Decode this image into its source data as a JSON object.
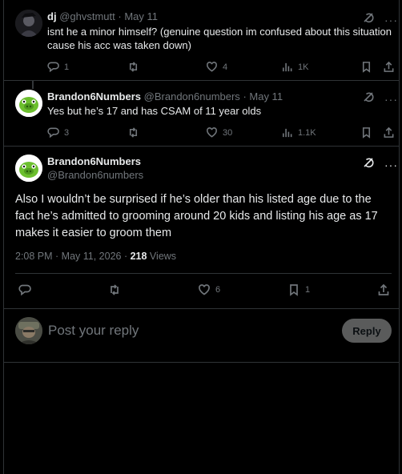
{
  "tweets": [
    {
      "name": "dj",
      "handle": "@ghvstmutt",
      "date": "· May 11",
      "text": "isnt he a minor himself? (genuine question im confused about this situation cause his acc was taken down)",
      "replies": "1",
      "reposts": "",
      "likes": "4",
      "views": "1K"
    },
    {
      "name": "Brandon6Numbers",
      "handle": "@Brandon6numbers",
      "date": "· May 11",
      "text": "Yes but he’s 17 and has CSAM of 11 year olds",
      "replies": "3",
      "reposts": "",
      "likes": "30",
      "views": "1.1K"
    }
  ],
  "main": {
    "name": "Brandon6Numbers",
    "handle": "@Brandon6numbers",
    "text": "Also I wouldn’t be surprised if he’s older than his listed age due to the fact he’s admitted to grooming around 20 kids and listing his age as 17 makes it easier to groom them",
    "timestamp": "2:08 PM · May 11, 2026 · ",
    "views_count": "218",
    "views_label": " Views",
    "replies": "",
    "reposts": "",
    "likes": "6",
    "bookmarks": "1"
  },
  "reply": {
    "placeholder": "Post your reply",
    "button": "Reply"
  },
  "icons": {
    "grok": "grok-icon",
    "more": "more-icon",
    "reply": "reply-icon",
    "repost": "repost-icon",
    "like": "like-icon",
    "views": "views-icon",
    "bookmark": "bookmark-icon",
    "share": "share-icon"
  },
  "colors": {
    "background": "#000000",
    "text": "#e7e9ea",
    "muted": "#71767b",
    "border": "#2f3336"
  }
}
